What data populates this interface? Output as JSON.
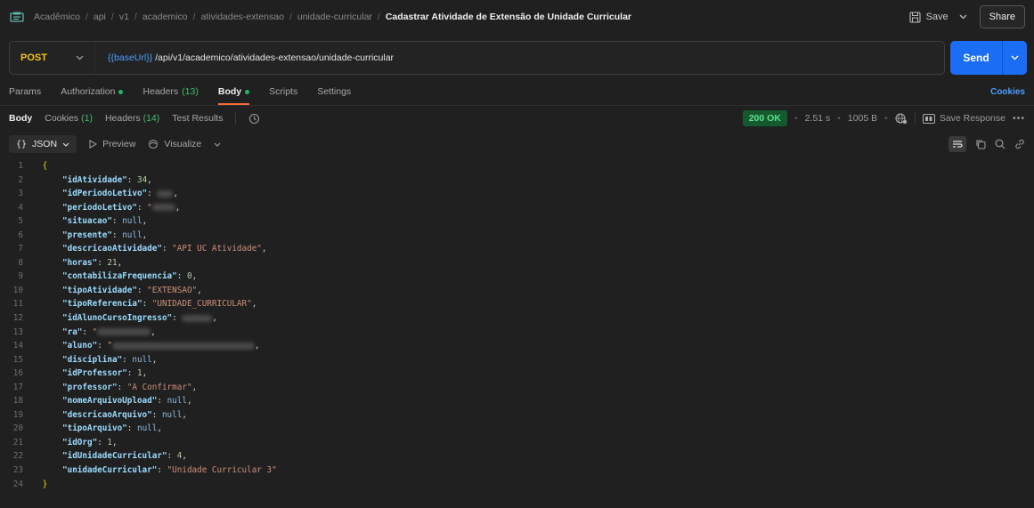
{
  "header": {
    "breadcrumbs": [
      "Acadêmico",
      "api",
      "v1",
      "academico",
      "atividades-extensao",
      "unidade-curricular"
    ],
    "current": "Cadastrar Atividade de Extensão de Unidade Curricular",
    "save_label": "Save",
    "share_label": "Share"
  },
  "request": {
    "method": "POST",
    "url_var": "{{baseUrl}}",
    "url_path": "/api/v1/academico/atividades-extensao/unidade-curricular",
    "send_label": "Send"
  },
  "request_tabs": {
    "params": "Params",
    "authorization": "Authorization",
    "headers": "Headers",
    "headers_count": "(13)",
    "body": "Body",
    "scripts": "Scripts",
    "settings": "Settings",
    "cookies": "Cookies"
  },
  "response_tabs": {
    "body": "Body",
    "cookies": "Cookies",
    "cookies_count": "(1)",
    "headers": "Headers",
    "headers_count": "(14)",
    "test_results": "Test Results"
  },
  "response_meta": {
    "status": "200 OK",
    "time": "2.51 s",
    "size": "1005 B",
    "save_response": "Save Response"
  },
  "toolbar": {
    "format": "JSON",
    "preview": "Preview",
    "visualize": "Visualize"
  },
  "json_body": {
    "open": "{",
    "close": "}",
    "lines": [
      {
        "key": "idAtividade",
        "value": "34",
        "type": "num"
      },
      {
        "key": "idPeriodoLetivo",
        "value": "",
        "type": "blur",
        "w": 18
      },
      {
        "key": "periodoLetivo",
        "value": "",
        "type": "blurstr",
        "w": 26
      },
      {
        "key": "situacao",
        "value": "null",
        "type": "nul"
      },
      {
        "key": "presente",
        "value": "null",
        "type": "nul"
      },
      {
        "key": "descricaoAtividade",
        "value": "\"API UC Atividade\"",
        "type": "str"
      },
      {
        "key": "horas",
        "value": "21",
        "type": "num"
      },
      {
        "key": "contabilizaFrequencia",
        "value": "0",
        "type": "num"
      },
      {
        "key": "tipoAtividade",
        "value": "\"EXTENSAO\"",
        "type": "str"
      },
      {
        "key": "tipoReferencia",
        "value": "\"UNIDADE_CURRICULAR\"",
        "type": "str"
      },
      {
        "key": "idAlunoCursoIngresso",
        "value": "",
        "type": "blur",
        "w": 34
      },
      {
        "key": "ra",
        "value": "",
        "type": "blurstr",
        "w": 60
      },
      {
        "key": "aluno",
        "value": "",
        "type": "blurstr",
        "w": 160
      },
      {
        "key": "disciplina",
        "value": "null",
        "type": "nul"
      },
      {
        "key": "idProfessor",
        "value": "1",
        "type": "num"
      },
      {
        "key": "professor",
        "value": "\"A Confirmar\"",
        "type": "str"
      },
      {
        "key": "nomeArquivoUpload",
        "value": "null",
        "type": "nul"
      },
      {
        "key": "descricaoArquivo",
        "value": "null",
        "type": "nul"
      },
      {
        "key": "tipoArquivo",
        "value": "null",
        "type": "nul"
      },
      {
        "key": "idOrg",
        "value": "1",
        "type": "num"
      },
      {
        "key": "idUnidadeCurricular",
        "value": "4",
        "type": "num"
      },
      {
        "key": "unidadeCurricular",
        "value": "\"Unidade Curricular 3\"",
        "type": "str",
        "last": true
      }
    ]
  },
  "colors": {
    "accent": "#ff6c37",
    "send": "#1b6ef3",
    "method": "#f5c518",
    "status_ok": "#5ee08d"
  }
}
